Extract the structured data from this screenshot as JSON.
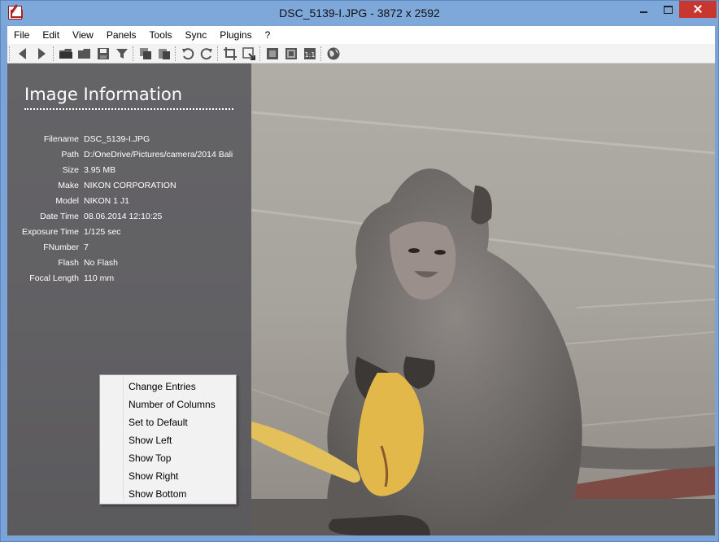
{
  "window": {
    "title": "DSC_5139-I.JPG  - 3872 x 2592"
  },
  "menubar": {
    "items": [
      "File",
      "Edit",
      "View",
      "Panels",
      "Tools",
      "Sync",
      "Plugins",
      "?"
    ]
  },
  "toolbar": {
    "icons": [
      "back-arrow-icon",
      "forward-arrow-icon",
      "open-folder-icon",
      "folder-icon",
      "save-icon",
      "filter-icon",
      "copy-icon",
      "paste-icon",
      "rotate-left-icon",
      "rotate-right-icon",
      "crop-icon",
      "resize-icon",
      "fit-window-icon",
      "fullscreen-icon",
      "actual-size-icon",
      "globe-icon"
    ],
    "actual_size_label": "1:1"
  },
  "info_panel": {
    "heading": "Image Information",
    "rows": [
      {
        "key": "Filename",
        "value": "DSC_5139-I.JPG"
      },
      {
        "key": "Path",
        "value": "D:/OneDrive/Pictures/camera/2014 Bali"
      },
      {
        "key": "Size",
        "value": "3.95 MB"
      },
      {
        "key": "Make",
        "value": "NIKON CORPORATION"
      },
      {
        "key": "Model",
        "value": "NIKON 1 J1"
      },
      {
        "key": "Date Time",
        "value": "08.06.2014 12:10:25"
      },
      {
        "key": "Exposure Time",
        "value": "1/125 sec"
      },
      {
        "key": "FNumber",
        "value": "7"
      },
      {
        "key": "Flash",
        "value": "No Flash"
      },
      {
        "key": "Focal Length",
        "value": "110 mm"
      }
    ]
  },
  "context_menu": {
    "items": [
      "Change Entries",
      "Number of Columns",
      "Set to Default",
      "Show Left",
      "Show Top",
      "Show Right",
      "Show Bottom"
    ]
  },
  "colors": {
    "titlebar": "#7ea7da",
    "close_button": "#c7372f",
    "panel_overlay": "#46464e"
  }
}
